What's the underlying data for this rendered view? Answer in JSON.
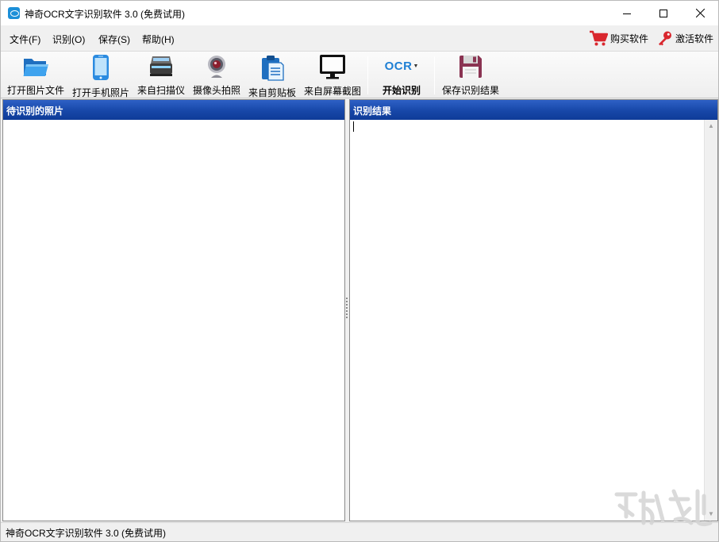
{
  "window": {
    "title": "神奇OCR文字识别软件 3.0 (免费试用)",
    "controls": [
      "minimize",
      "maximize",
      "close"
    ]
  },
  "menu": {
    "items": [
      {
        "label": "文件(F)"
      },
      {
        "label": "识别(O)"
      },
      {
        "label": "保存(S)"
      },
      {
        "label": "帮助(H)"
      }
    ],
    "buy_label": "购买软件",
    "activate_label": "激活软件"
  },
  "toolbar": {
    "buttons": [
      {
        "label": "打开图片文件",
        "icon": "folder-icon"
      },
      {
        "label": "打开手机照片",
        "icon": "phone-icon"
      },
      {
        "label": "来自扫描仪",
        "icon": "scanner-icon"
      },
      {
        "label": "摄像头拍照",
        "icon": "webcam-icon"
      },
      {
        "label": "来自剪贴板",
        "icon": "clipboard-icon"
      },
      {
        "label": "来自屏幕截图",
        "icon": "monitor-icon"
      },
      {
        "label": "开始识别",
        "icon": "ocr-icon",
        "icon_text": "OCR"
      },
      {
        "label": "保存识别结果",
        "icon": "floppy-disk-icon"
      }
    ]
  },
  "panels": {
    "left_title": "待识别的照片",
    "right_title": "识别结果"
  },
  "statusbar": {
    "text": "神奇OCR文字识别软件 3.0 (免费试用)"
  },
  "colors": {
    "panel_header": "#1747a8",
    "ocr_blue": "#1e7fd4",
    "cart_red": "#d9272e"
  }
}
